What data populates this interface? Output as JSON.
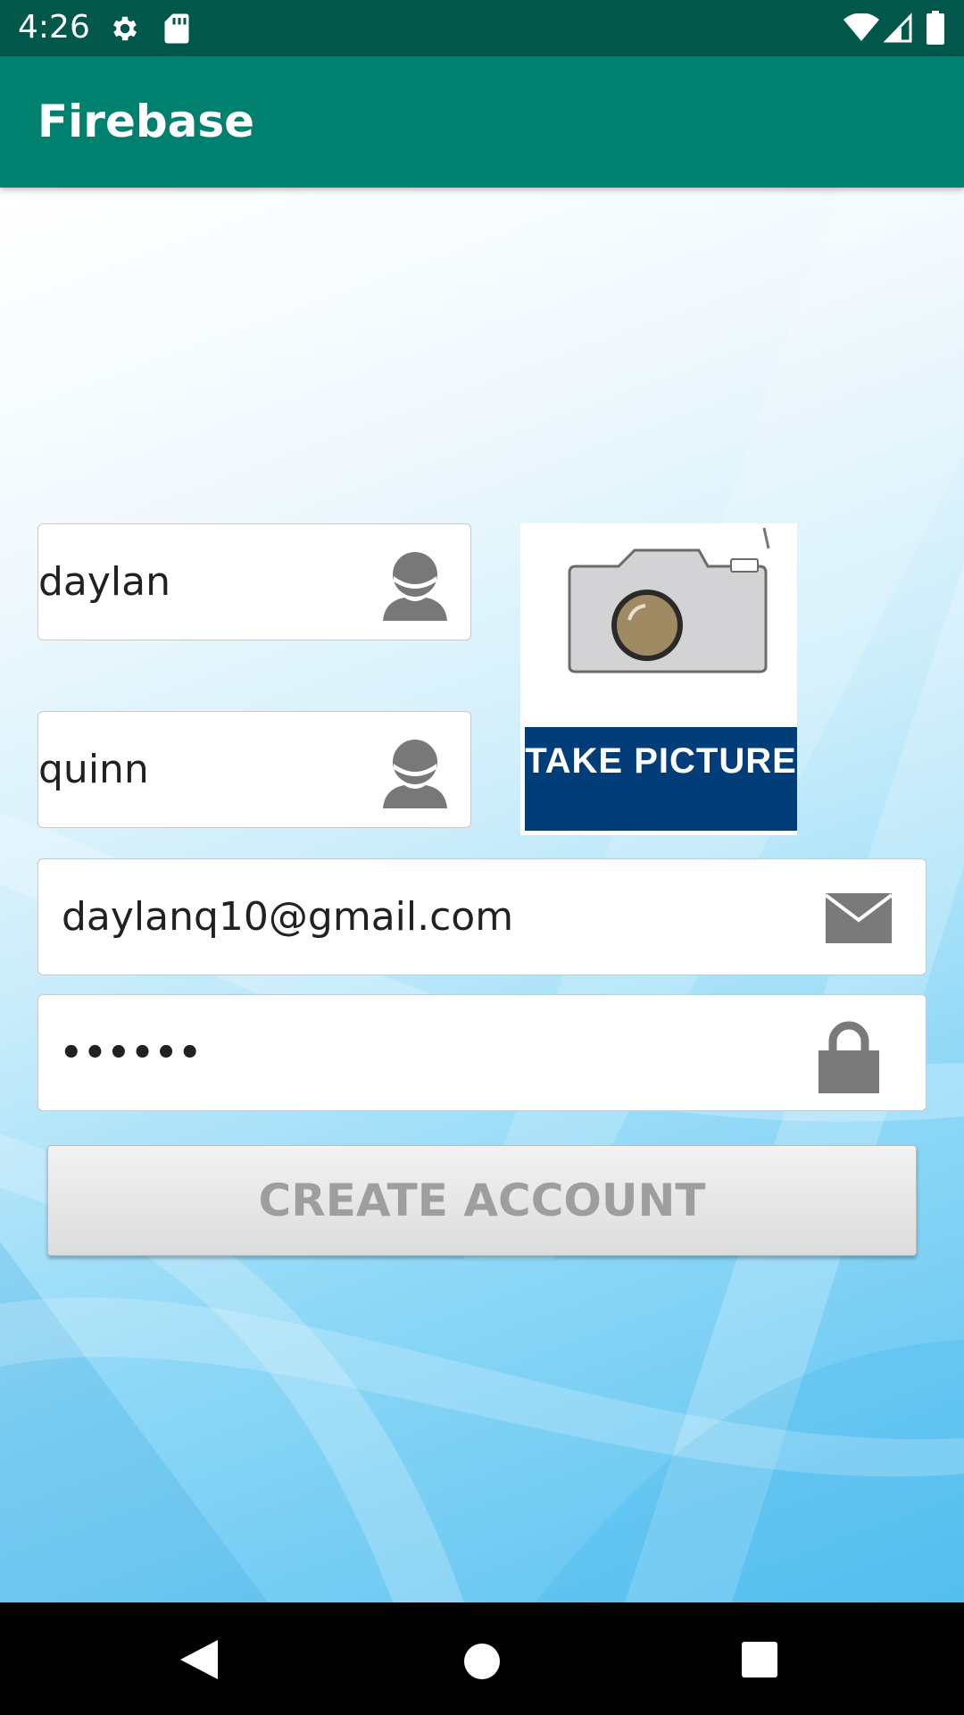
{
  "status_bar": {
    "time": "4:26",
    "icons": [
      "gear-icon",
      "sd-card-icon",
      "wifi-icon",
      "signal-icon",
      "battery-icon"
    ]
  },
  "app_bar": {
    "title": "Firebase",
    "color": "#00806f"
  },
  "form": {
    "first_name": {
      "value": "daylan",
      "icon": "person-icon"
    },
    "last_name": {
      "value": "quinn",
      "icon": "person-icon"
    },
    "email": {
      "value": "daylanq10@gmail.com",
      "icon": "mail-icon"
    },
    "password": {
      "value": "••••••",
      "icon": "lock-icon"
    },
    "take_picture": {
      "label": "TAKE PICTURE",
      "icon": "camera-icon",
      "banner_color": "#003d79"
    },
    "create_account_label": "CREATE ACCOUNT"
  },
  "nav_bar": {
    "icons": [
      "back-icon",
      "home-icon",
      "recents-icon"
    ]
  }
}
